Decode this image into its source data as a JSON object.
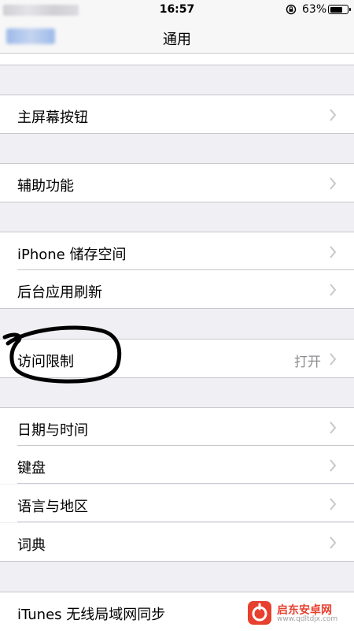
{
  "status_bar": {
    "time": "16:57",
    "battery": "63%"
  },
  "nav": {
    "title": "通用",
    "back_label": ""
  },
  "rows": {
    "home_button": "主屏幕按钮",
    "accessibility": "辅助功能",
    "iphone_storage": "iPhone 储存空间",
    "background_refresh": "后台应用刷新",
    "restrictions": "访问限制",
    "restrictions_value": "打开",
    "date_time": "日期与时间",
    "keyboard": "键盘",
    "language_region": "语言与地区",
    "dictionary": "词典",
    "itunes_wifi_sync": "iTunes 无线局域网同步"
  },
  "watermark": {
    "text": "启东安卓网",
    "url": "www.qdltdjx.com"
  },
  "colors": {
    "group_bg": "#efeff4",
    "separator": "#c8c7cc",
    "secondary_text": "#8e8e93",
    "annotation": "#000000"
  }
}
